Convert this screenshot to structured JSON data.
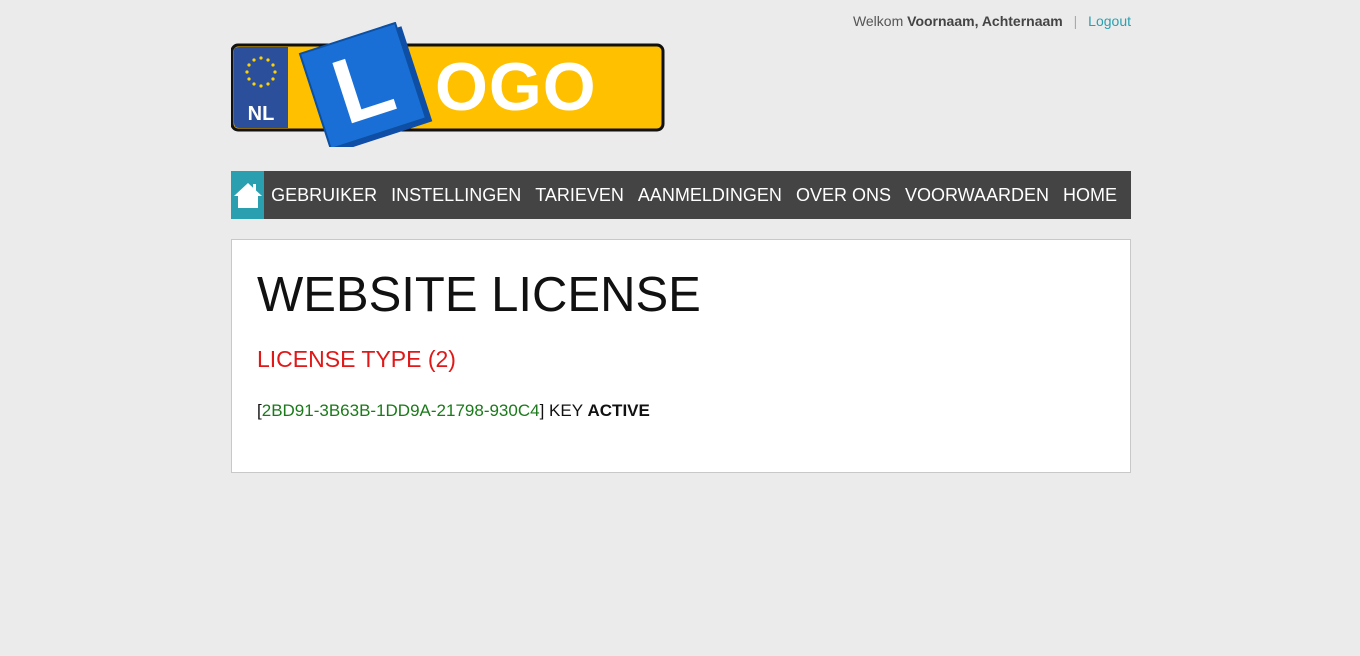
{
  "header": {
    "welcome_label": "Welkom",
    "user_name": "Voornaam, Achternaam",
    "separator": "|",
    "logout_label": "Logout"
  },
  "logo": {
    "country_code": "NL",
    "letter": "L",
    "text": "OGO",
    "colors": {
      "plate_yellow": "#ffc000",
      "eu_blue": "#2c4f9c",
      "l_blue": "#1a6fd6"
    }
  },
  "nav": {
    "home_icon": "house-icon",
    "items": [
      {
        "label": "GEBRUIKER"
      },
      {
        "label": "INSTELLINGEN"
      },
      {
        "label": "TARIEVEN"
      },
      {
        "label": "AANMELDINGEN"
      },
      {
        "label": "OVER ONS"
      },
      {
        "label": "VOORWAARDEN"
      },
      {
        "label": "HOME"
      }
    ]
  },
  "main": {
    "title": "WEBSITE LICENSE",
    "license_type": "LICENSE TYPE (2)",
    "bracket_open": "[",
    "license_key": "2BD91-3B63B-1DD9A-21798-930C4",
    "bracket_close": "]",
    "key_label": "KEY",
    "status": "ACTIVE"
  },
  "colors": {
    "accent": "#2a9fb0",
    "nav_bg": "#444444",
    "license_type": "#e01818",
    "license_key": "#1a7a1a"
  }
}
